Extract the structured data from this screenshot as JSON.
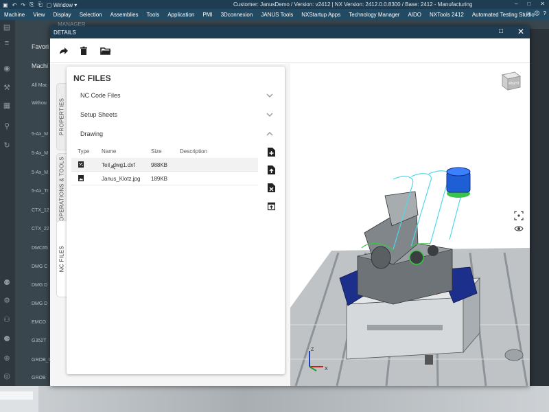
{
  "nx": {
    "quick_access": {
      "window_label": "Window"
    },
    "caption": "Customer: JanusDemo / Version: v2412 | NX Version: 2412.0.0.8300 / Base: 2412 - Manufacturing",
    "menu": [
      "Machine",
      "View",
      "Display",
      "Selection",
      "Assemblies",
      "Tools",
      "Application",
      "PMI",
      "3Dconnexion",
      "JANUS Tools",
      "NXStartup Apps",
      "Technology Manager",
      "AIDO",
      "NXTools 2412",
      "Automated Testing Studio"
    ],
    "ribbon_text": "TECHNOLOGY MANAGER",
    "panel": {
      "headers": [
        "Favori",
        "Machi"
      ],
      "items": [
        "All Mac",
        "Withou",
        "5-Ax_M",
        "5-Ax_M",
        "5-Ax_M",
        "5-Ax_Tr",
        "CTX_12",
        "CTX_22",
        "DMC65",
        "DMG C",
        "DMG D",
        "DMG D",
        "EMCO",
        "G352T",
        "GROB_C",
        "GROB"
      ]
    }
  },
  "details": {
    "title": "DETAILS",
    "toolbar": {
      "share_icon": "share-icon",
      "delete_icon": "trash-icon",
      "open_icon": "folder-open-icon"
    },
    "vertical_tabs": [
      {
        "label": "PROPERTIES",
        "active": false
      },
      {
        "label": "OPERATIONS & TOOLS",
        "active": false
      },
      {
        "label": "NC FILES",
        "active": true
      }
    ],
    "nc_files": {
      "title": "NC FILES",
      "sections": [
        {
          "label": "NC Code Files",
          "expanded": false
        },
        {
          "label": "Setup Sheets",
          "expanded": false
        },
        {
          "label": "Drawing",
          "expanded": true
        }
      ],
      "columns": {
        "type": "Type",
        "name": "Name",
        "size": "Size",
        "description": "Description"
      },
      "files": [
        {
          "name": "Teil_dwg1.dxf",
          "size": "988KB",
          "description": "",
          "icon": "dxf-file-icon"
        },
        {
          "name": "Janus_Klotz.jpg",
          "size": "189KB",
          "description": "",
          "icon": "image-file-icon"
        }
      ],
      "actions": [
        "file-add-icon",
        "file-upload-icon",
        "file-remove-icon",
        "export-icon"
      ]
    },
    "viewport": {
      "cube_label": "RIGHT",
      "axes": {
        "z": "Z",
        "x": "X"
      },
      "colors": {
        "fixture_blue": "#1c2f8a",
        "tool_blue": "#1f5fd6",
        "path_cyan": "#4fd8ea",
        "path_green": "#39c34a"
      }
    }
  }
}
